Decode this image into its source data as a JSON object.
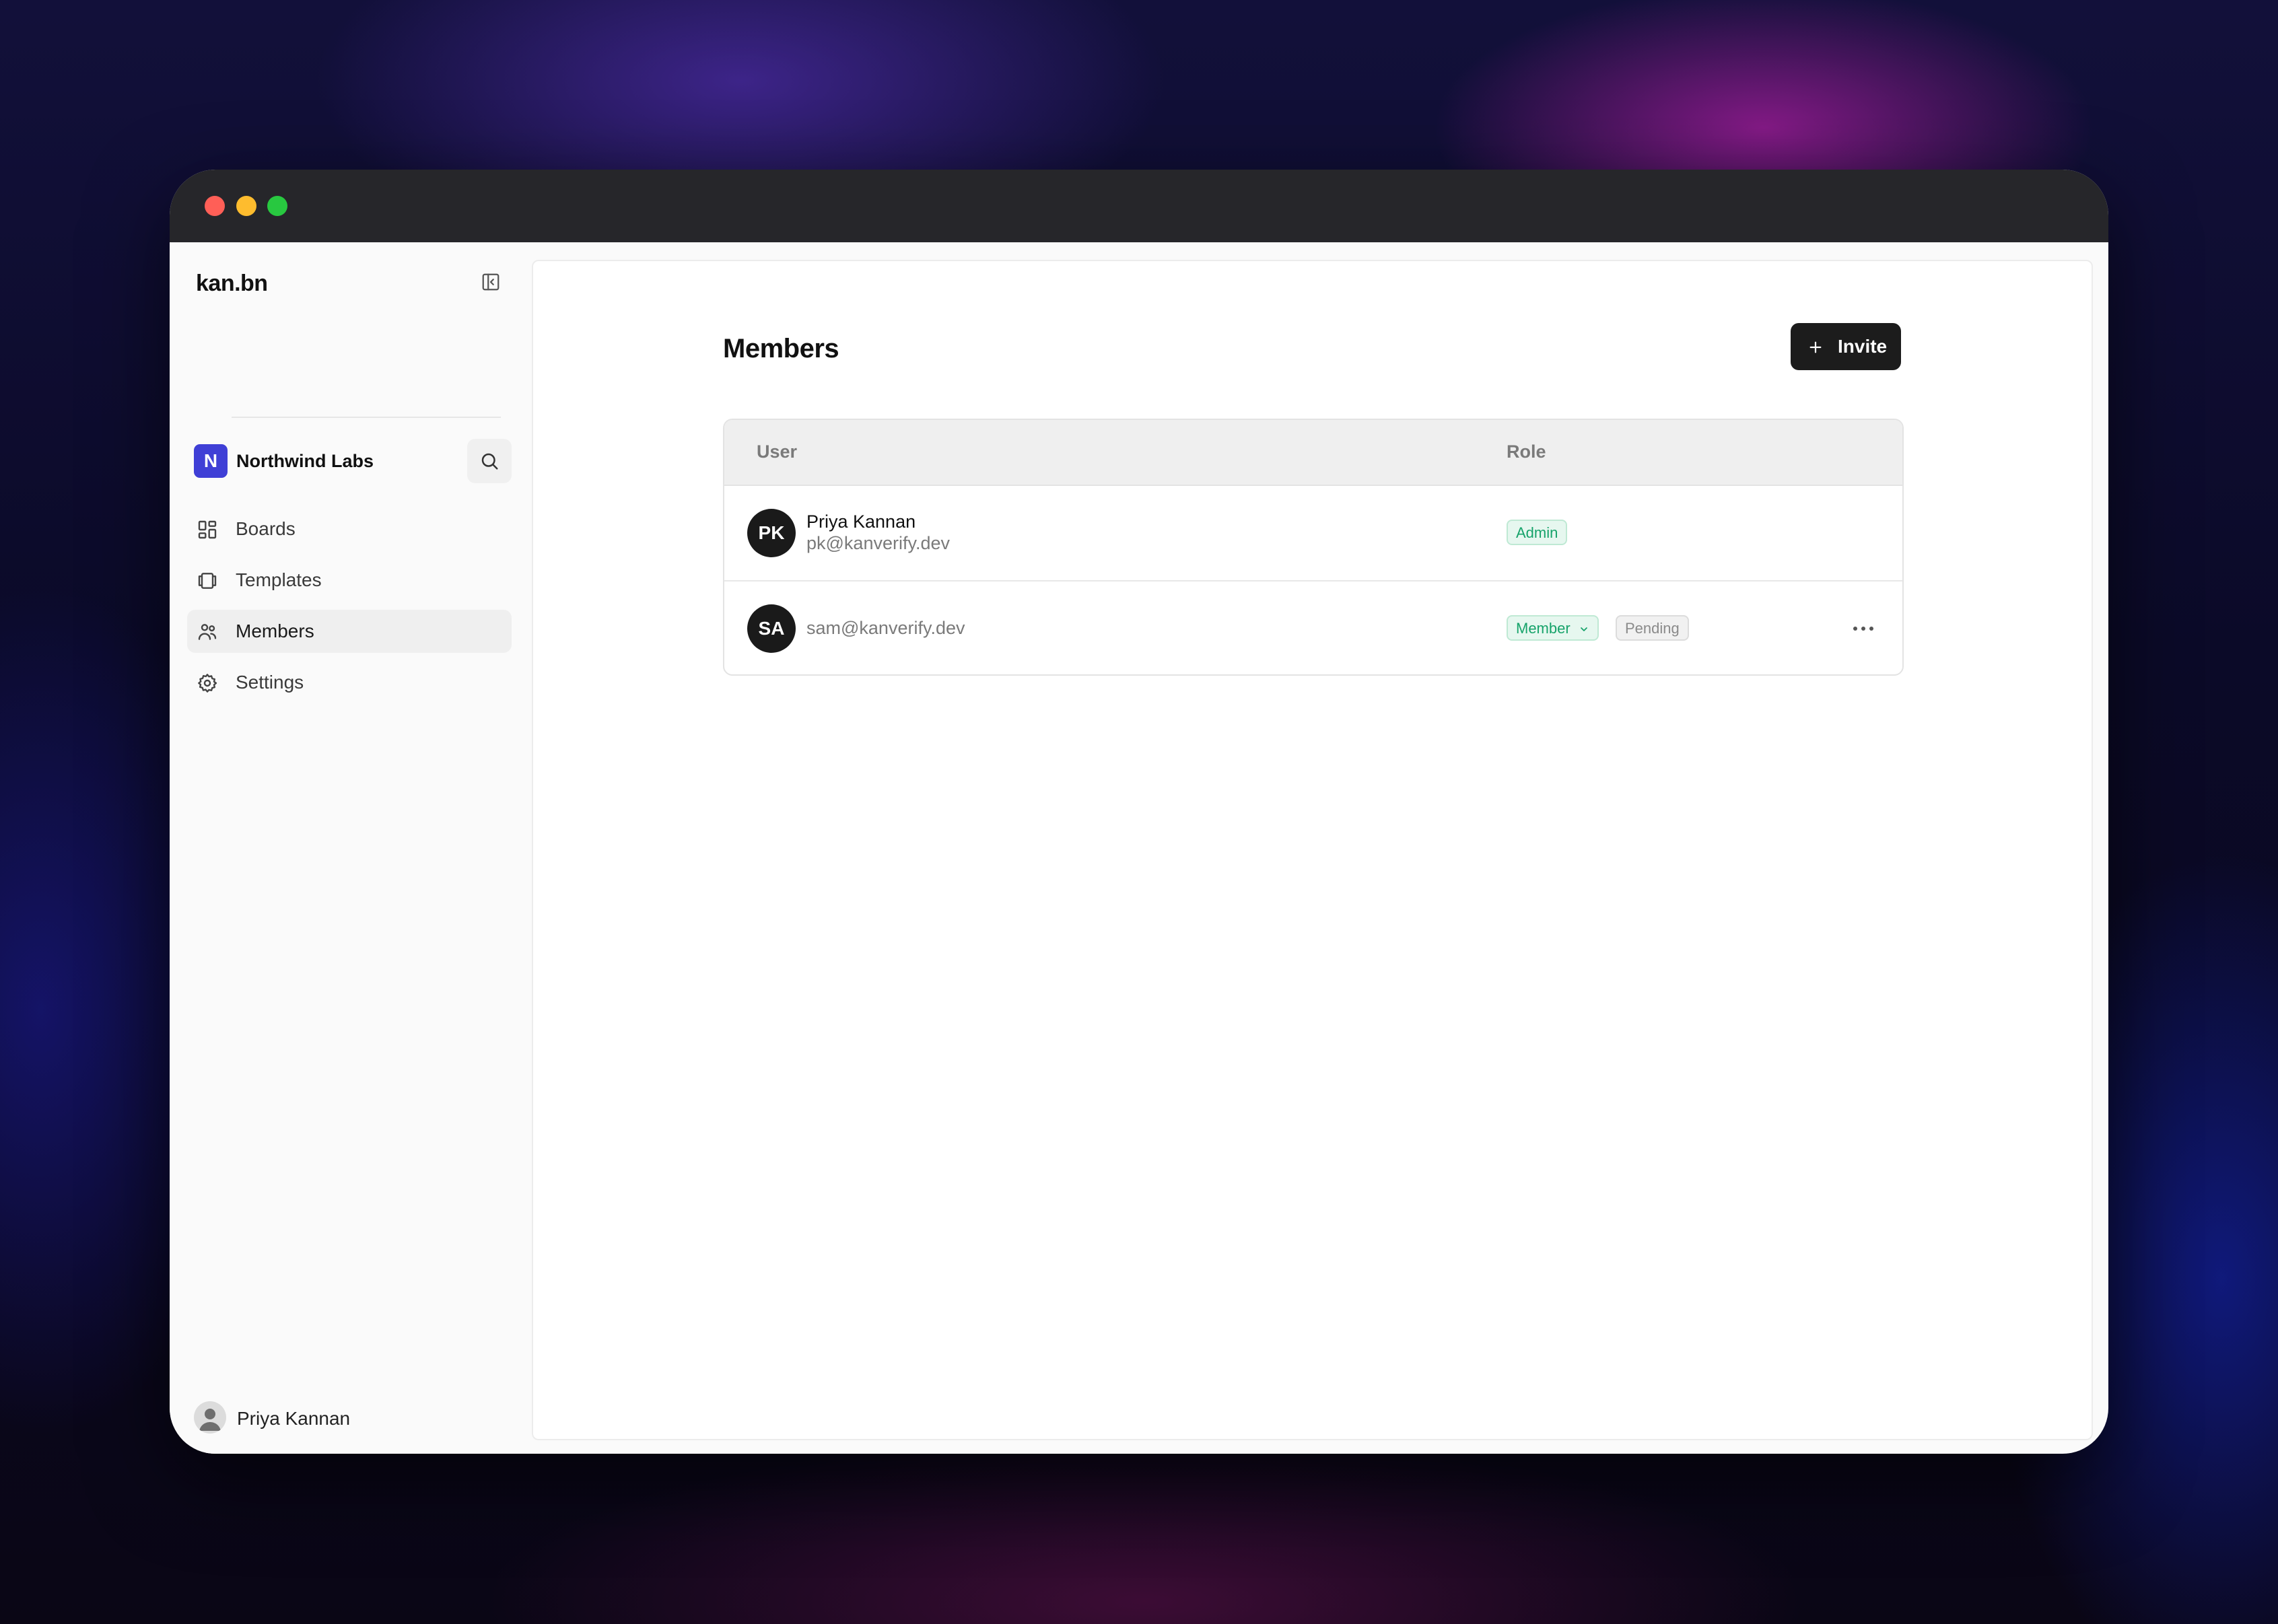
{
  "app": {
    "brand": "kan.bn"
  },
  "workspace": {
    "initial": "N",
    "name": "Northwind Labs",
    "accent": "#3f3fd6"
  },
  "sidebar": {
    "items": [
      {
        "id": "boards",
        "label": "Boards",
        "icon": "grid-icon",
        "active": false
      },
      {
        "id": "templates",
        "label": "Templates",
        "icon": "templates-icon",
        "active": false
      },
      {
        "id": "members",
        "label": "Members",
        "icon": "users-icon",
        "active": true
      },
      {
        "id": "settings",
        "label": "Settings",
        "icon": "gear-icon",
        "active": false
      }
    ],
    "user": {
      "name": "Priya Kannan"
    }
  },
  "main": {
    "title": "Members",
    "invite_label": "Invite",
    "table": {
      "headers": {
        "user": "User",
        "role": "Role"
      },
      "rows": [
        {
          "initials": "PK",
          "name": "Priya Kannan",
          "email": "pk@kanverify.dev",
          "role": "Admin",
          "status": ""
        },
        {
          "initials": "SA",
          "name": "",
          "email": "sam@kanverify.dev",
          "role": "Member",
          "status": "Pending"
        }
      ]
    }
  }
}
